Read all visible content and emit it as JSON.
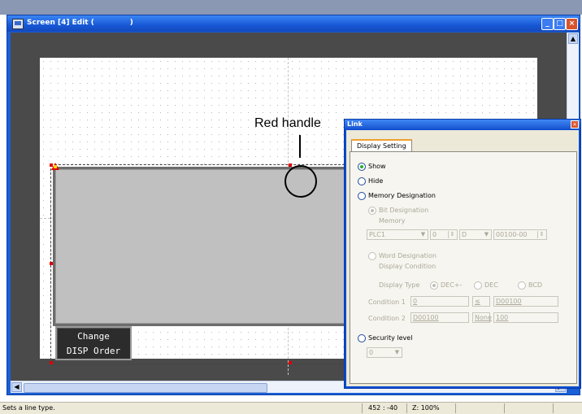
{
  "window": {
    "title": "Screen [4] Edit (              )"
  },
  "canvas": {
    "callout": "Red handle",
    "switch_label_line1": "Change",
    "switch_label_line2": "DISP Order"
  },
  "status": {
    "message": "Sets a line type.",
    "coords": "452 : -40",
    "zoom": "Z: 100%"
  },
  "dialog": {
    "title": "Link",
    "tab": "Display Setting",
    "show": "Show",
    "hide": "Hide",
    "memory_designation": "Memory Designation",
    "bit_designation": "Bit Designation",
    "memory": "Memory",
    "plc": "PLC1",
    "num": "0",
    "dev": "D",
    "address": "00100-00",
    "word_designation": "Word Designation",
    "display_condition": "Display Condition",
    "display_type": "Display Type",
    "dec_pm": "DEC+-",
    "dec": "DEC",
    "bcd": "BCD",
    "condition1": "Condition 1",
    "condition2": "Condition 2",
    "c1_left": "0",
    "c1_op": "≤",
    "c1_right": "D00100",
    "c2_left": "D00100",
    "c2_op": "None",
    "c2_right": "100",
    "security_level": "Security level",
    "security_value": "0",
    "show_selected": true
  },
  "colors": {
    "handle": "#e00000",
    "titlebar": "#1758d6",
    "canvas_bg": "#4a4a4a"
  }
}
